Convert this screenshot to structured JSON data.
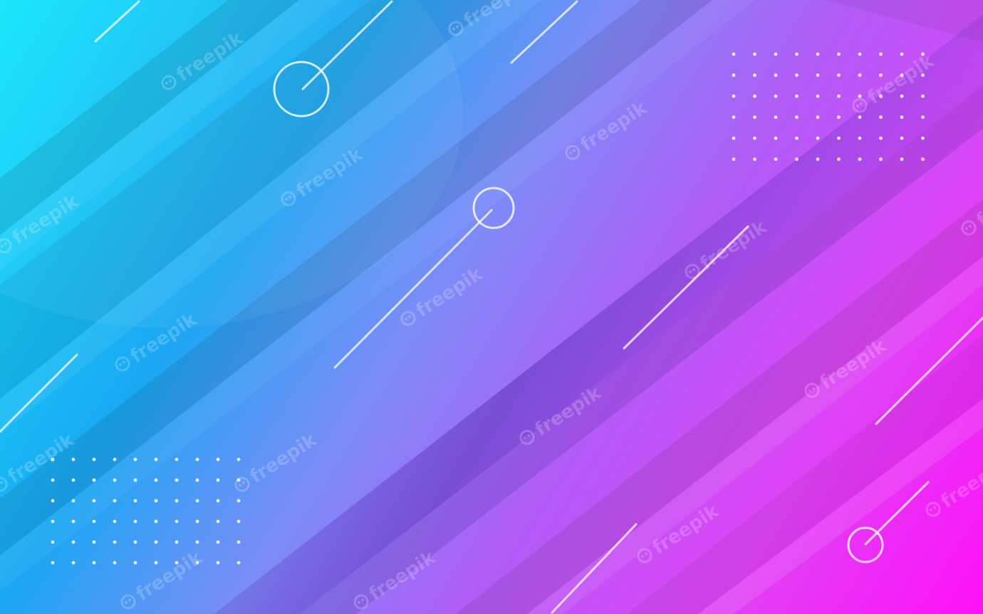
{
  "watermark": {
    "text": "freepik",
    "icon": "freepik-logo-icon"
  },
  "colors": {
    "cyan": "#0ee6fb",
    "sky_blue": "#1aa8f2",
    "periwinkle": "#7d8df8",
    "violet": "#b15cf6",
    "purple_deep": "#6a36c8",
    "orchid": "#d84cf5",
    "magenta": "#ff10f7",
    "ornament": "#ffffff"
  }
}
